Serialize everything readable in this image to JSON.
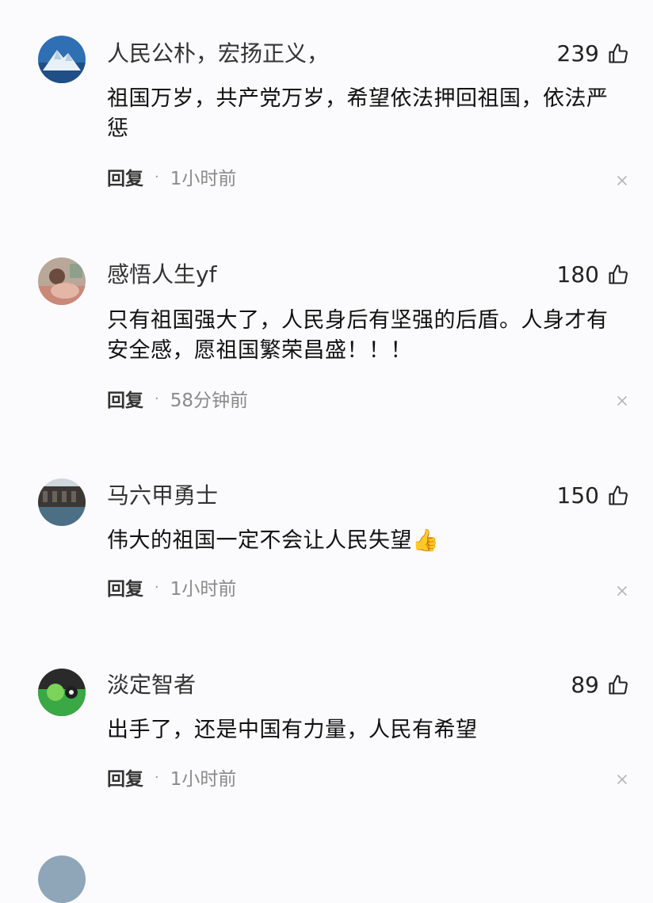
{
  "comments": [
    {
      "username": "人民公朴，宏扬正义，",
      "likes": "239",
      "content": "祖国万岁，共产党万岁，希望依法押回祖国，依法严惩",
      "reply_label": "回复",
      "separator": "·",
      "time": "1小时前",
      "avatar_icon": "mountain-avatar-icon"
    },
    {
      "username": "感悟人生yf",
      "likes": "180",
      "content": "只有祖国强大了，人民身后有坚强的后盾。人身才有安全感，愿祖国繁荣昌盛！！！",
      "reply_label": "回复",
      "separator": "·",
      "time": "58分钟前",
      "avatar_icon": "person-photo-avatar-icon"
    },
    {
      "username": "马六甲勇士",
      "likes": "150",
      "content": "伟大的祖国一定不会让人民失望👍",
      "reply_label": "回复",
      "separator": "·",
      "time": "1小时前",
      "avatar_icon": "landscape-avatar-icon"
    },
    {
      "username": "淡定智者",
      "likes": "89",
      "content": "出手了，还是中国有力量，人民有希望",
      "reply_label": "回复",
      "separator": "·",
      "time": "1小时前",
      "avatar_icon": "billiard-avatar-icon"
    }
  ],
  "icons": {
    "like": "thumbs-up-icon",
    "dismiss": "close-icon"
  }
}
